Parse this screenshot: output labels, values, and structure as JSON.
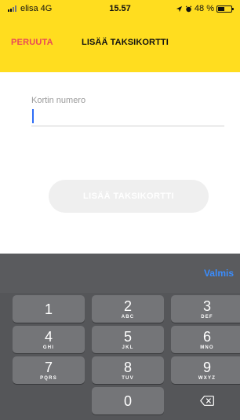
{
  "status_bar": {
    "carrier": "elisa",
    "network": "4G",
    "time": "15.57",
    "battery": "48 %",
    "battery_level": 0.48,
    "icons": [
      "signal-icon",
      "location-icon",
      "alarm-icon",
      "battery-icon"
    ]
  },
  "header": {
    "cancel_label": "PERUUTA",
    "title": "LISÄÄ TAKSIKORTTI"
  },
  "form": {
    "card_number_label": "Kortin numero",
    "card_number_value": "",
    "submit_label": "LISÄÄ TAKSIKORTTI"
  },
  "keyboard": {
    "done_label": "Valmis",
    "keys": [
      {
        "num": "1",
        "letters": ""
      },
      {
        "num": "2",
        "letters": "ABC"
      },
      {
        "num": "3",
        "letters": "DEF"
      },
      {
        "num": "4",
        "letters": "GHI"
      },
      {
        "num": "5",
        "letters": "JKL"
      },
      {
        "num": "6",
        "letters": "MNO"
      },
      {
        "num": "7",
        "letters": "PQRS"
      },
      {
        "num": "8",
        "letters": "TUV"
      },
      {
        "num": "9",
        "letters": "WXYZ"
      },
      {
        "num": "0",
        "letters": ""
      }
    ],
    "backspace_icon": "backspace-icon"
  },
  "colors": {
    "header_bg": "#ffdd1f",
    "cancel_text": "#e84a57",
    "caret": "#2d6cf6",
    "done_text": "#3a8dff",
    "keyboard_bg": "#555659",
    "key_bg": "#747578",
    "disabled_button_bg": "#efefef"
  }
}
